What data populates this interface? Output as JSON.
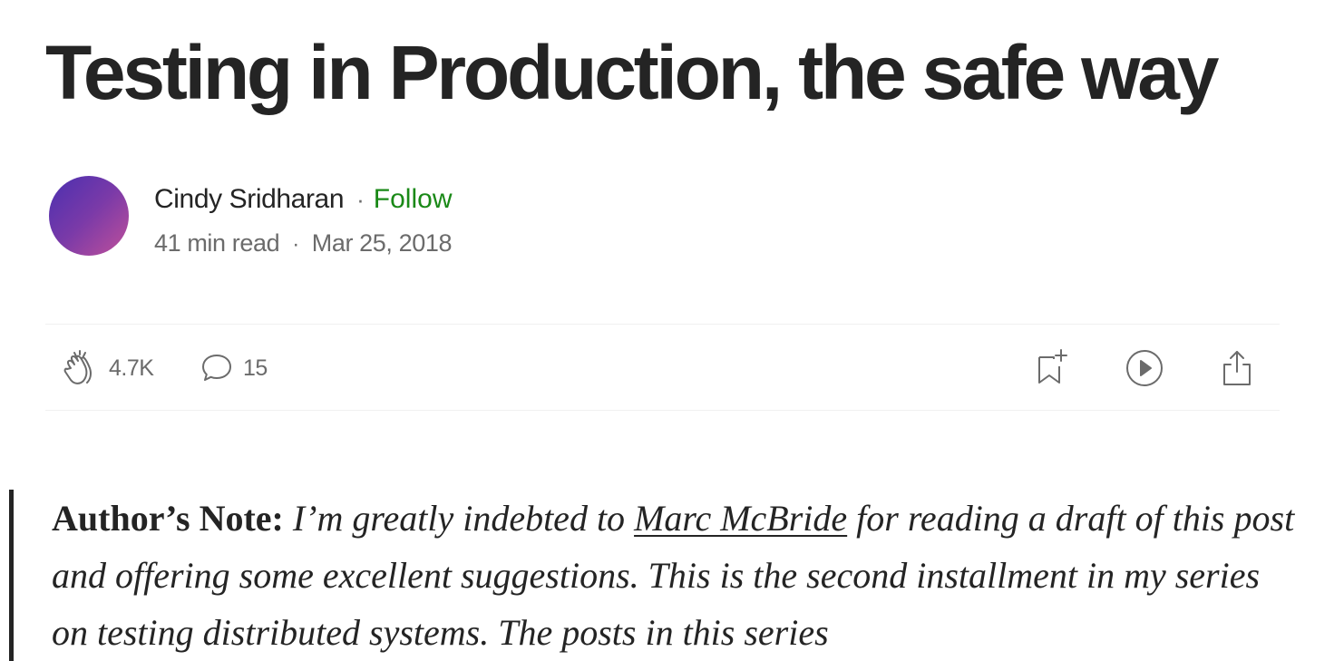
{
  "article": {
    "title": "Testing in Production, the safe way"
  },
  "author": {
    "name": "Cindy Sridharan",
    "separator": "·",
    "follow_label": "Follow",
    "read_time": "41 min read",
    "meta_separator": "·",
    "date": "Mar 25, 2018"
  },
  "actions": {
    "clap_icon": "clap-icon",
    "clap_count": "4.7K",
    "comment_icon": "comment-icon",
    "comment_count": "15",
    "bookmark_icon": "bookmark-add-icon",
    "listen_icon": "play-icon",
    "share_icon": "share-icon"
  },
  "body": {
    "note_lead": "Author’s Note:",
    "note_text_1": "I’m greatly indebted to",
    "note_link": "Marc McBride",
    "note_text_2": "for reading a draft of this post and offering some excellent suggestions. This is the second installment in my series on testing distributed systems. The posts in this series"
  },
  "colors": {
    "text": "#242424",
    "muted": "#6b6b6b",
    "follow_green": "#1a8917",
    "divider": "#f0f0f0"
  }
}
